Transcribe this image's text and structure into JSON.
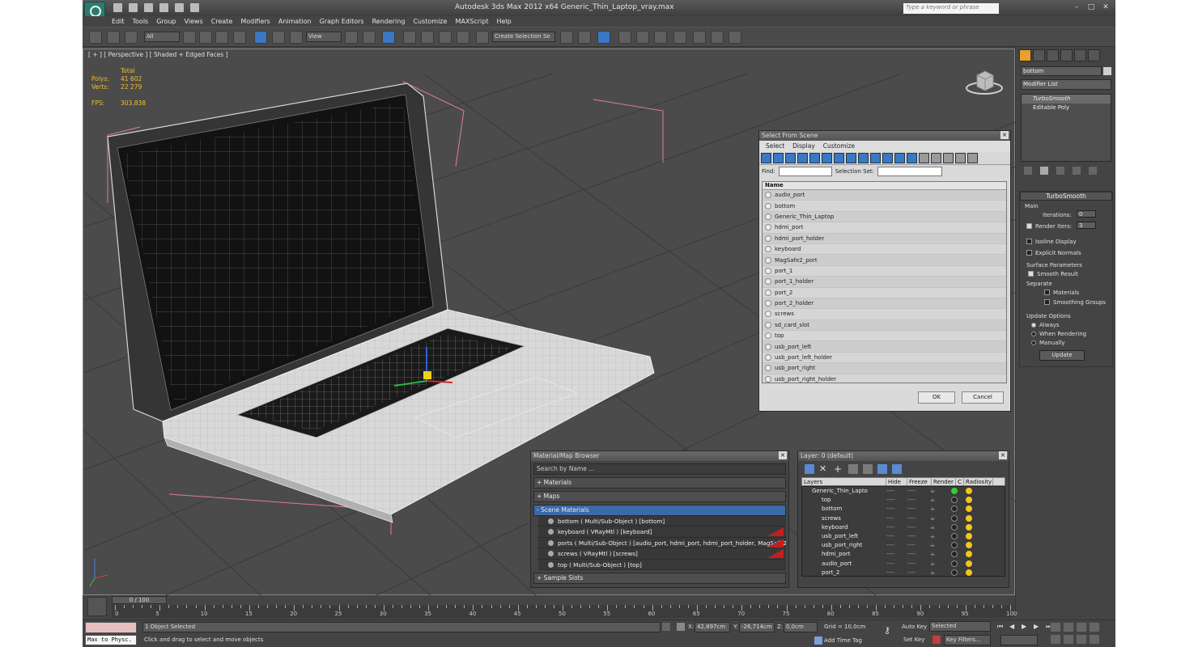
{
  "app": {
    "title": "Autodesk 3ds Max  2012 x64     Generic_Thin_Laptop_vray.max",
    "search_placeholder": "Type a keyword or phrase"
  },
  "menu": [
    "Edit",
    "Tools",
    "Group",
    "Views",
    "Create",
    "Modifiers",
    "Animation",
    "Graph Editors",
    "Rendering",
    "Customize",
    "MAXScript",
    "Help"
  ],
  "toolbar": {
    "selection_filter": "All",
    "ref_coord": "View",
    "named_selection": "Create Selection Se"
  },
  "viewport": {
    "label": "[ + ] [ Perspective ] [ Shaded + Edged Faces ]",
    "stats": {
      "total_label": "Total",
      "polys_label": "Polys:",
      "polys": "41 602",
      "verts_label": "Verts:",
      "verts": "22 279",
      "fps_label": "FPS:",
      "fps": "303,838"
    }
  },
  "select_from_scene": {
    "title": "Select From Scene",
    "menu": [
      "Select",
      "Display",
      "Customize"
    ],
    "find_label": "Find:",
    "selection_set_label": "Selection Set:",
    "column": "Name",
    "items": [
      "audio_port",
      "bottom",
      "Generic_Thin_Laptop",
      "hdmi_port",
      "hdmi_port_holder",
      "keyboard",
      "MagSafe2_port",
      "port_1",
      "port_1_holder",
      "port_2",
      "port_2_holder",
      "screws",
      "sd_card_slot",
      "top",
      "usb_port_left",
      "usb_port_left_holder",
      "usb_port_right",
      "usb_port_right_holder"
    ],
    "ok": "OK",
    "cancel": "Cancel"
  },
  "material_browser": {
    "title": "Material/Map Browser",
    "search": "Search by Name ...",
    "groups": [
      "+ Materials",
      "+ Maps",
      "- Scene Materials"
    ],
    "materials": [
      "bottom  ( Multi/Sub-Object )  [bottom]",
      "keyboard  ( VRayMtl )  [keyboard]",
      "ports  ( Multi/Sub-Object )  [audio_port, hdmi_port, hdmi_port_holder, MagSafe2...",
      "screws  ( VRayMtl )  [screws]",
      "top  ( Multi/Sub-Object )  [top]"
    ],
    "sample_slots": "+ Sample Slots"
  },
  "layer_panel": {
    "title": "Layer: 0 (default)",
    "columns": [
      "Layers",
      "Hide",
      "Freeze",
      "Render",
      "C",
      "Radiosity"
    ],
    "root": "Generic_Thin_Lapto",
    "layers": [
      "top",
      "bottom",
      "screws",
      "keyboard",
      "usb_port_left",
      "usb_port_right",
      "hdmi_port",
      "audio_port",
      "port_2"
    ],
    "dash": "----"
  },
  "command_panel": {
    "object_name": "bottom",
    "modifier_list": "Modifier List",
    "stack": [
      "TurboSmooth",
      "Editable Poly"
    ],
    "rollout_title": "TurboSmooth",
    "main_label": "Main",
    "iterations_label": "Iterations:",
    "iterations": "0",
    "render_iters_label": "Render Iters:",
    "render_iters": "3",
    "isoline": "Isoline Display",
    "explicit_normals": "Explicit Normals",
    "surface_params": "Surface Parameters",
    "smooth_result": "Smooth Result",
    "separate": "Separate",
    "materials": "Materials",
    "smoothing_groups": "Smoothing Groups",
    "update_options": "Update Options",
    "always": "Always",
    "when_rendering": "When Rendering",
    "manually": "Manually",
    "update_btn": "Update"
  },
  "timeline": {
    "slider": "0 / 100",
    "ticks": [
      "0",
      "5",
      "10",
      "15",
      "20",
      "25",
      "30",
      "35",
      "40",
      "45",
      "50",
      "55",
      "60",
      "65",
      "70",
      "75",
      "80",
      "85",
      "90",
      "95",
      "100"
    ]
  },
  "status": {
    "maxscript": "Max to Physc.",
    "selected": "1 Object Selected",
    "prompt": "Click and drag to select and move objects",
    "x_label": "X:",
    "x": "42,897cm",
    "y_label": "Y:",
    "y": "-26,714cm",
    "z_label": "Z:",
    "z": "0,0cm",
    "grid": "Grid = 10,0cm",
    "add_time_tag": "Add Time Tag",
    "auto_key": "Auto Key",
    "set_key": "Set Key",
    "key_mode": "Selected",
    "key_filters": "Key Filters..."
  }
}
